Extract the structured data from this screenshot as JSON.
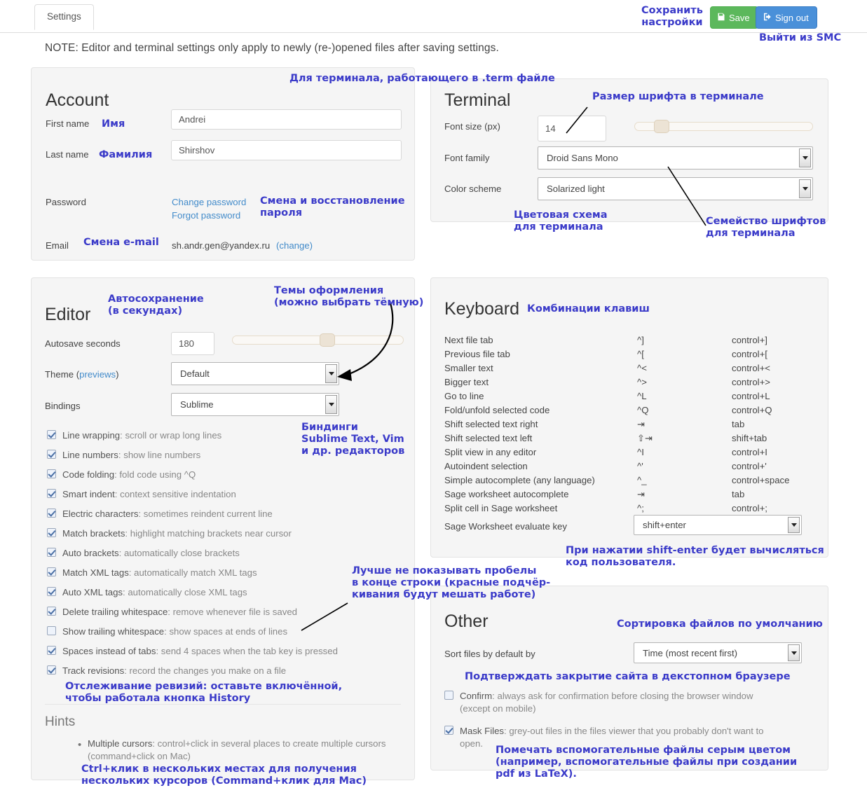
{
  "tab": {
    "label": "Settings"
  },
  "toolbar": {
    "save_label": "Save",
    "save_icon": "floppy-disk-icon",
    "signout_label": "Sign out",
    "signout_icon": "sign-out-icon",
    "save_color": "#5cb85c",
    "signout_color": "#4a90d9"
  },
  "note": "NOTE: Editor and terminal settings only apply to newly (re-)opened files after saving settings.",
  "account": {
    "title": "Account",
    "first_name_label": "First name",
    "first_name_value": "Andrei",
    "last_name_label": "Last name",
    "last_name_value": "Shirshov",
    "password_label": "Password",
    "change_password_link": "Change password",
    "forgot_password_link": "Forgot password",
    "email_label": "Email",
    "email_value": "sh.andr.gen@yandex.ru",
    "email_change_link": "(change)"
  },
  "terminal": {
    "title": "Terminal",
    "font_size_label": "Font size (px)",
    "font_size_value": "14",
    "font_size_slider_pct": 12,
    "font_family_label": "Font family",
    "font_family_value": "Droid Sans Mono",
    "color_scheme_label": "Color scheme",
    "color_scheme_value": "Solarized light"
  },
  "editor": {
    "title": "Editor",
    "autosave_label": "Autosave seconds",
    "autosave_value": "180",
    "autosave_slider_pct": 56,
    "theme_label": "Theme (",
    "theme_previews_link": "previews",
    "theme_label_close": ")",
    "theme_value": "Default",
    "bindings_label": "Bindings",
    "bindings_value": "Sublime",
    "checkboxes": [
      {
        "checked": true,
        "name": "Line wrapping",
        "desc": ": scroll or wrap long lines"
      },
      {
        "checked": true,
        "name": "Line numbers",
        "desc": ": show line numbers"
      },
      {
        "checked": true,
        "name": "Code folding",
        "desc": ": fold code using ^Q"
      },
      {
        "checked": true,
        "name": "Smart indent",
        "desc": ": context sensitive indentation"
      },
      {
        "checked": true,
        "name": "Electric characters",
        "desc": ": sometimes reindent current line"
      },
      {
        "checked": true,
        "name": "Match brackets",
        "desc": ": highlight matching brackets near cursor"
      },
      {
        "checked": true,
        "name": "Auto brackets",
        "desc": ": automatically close brackets"
      },
      {
        "checked": true,
        "name": "Match XML tags",
        "desc": ": automatically match XML tags"
      },
      {
        "checked": true,
        "name": "Auto XML tags",
        "desc": ": automatically close XML tags"
      },
      {
        "checked": true,
        "name": "Delete trailing whitespace",
        "desc": ": remove whenever file is saved"
      },
      {
        "checked": false,
        "name": "Show trailing whitespace",
        "desc": ": show spaces at ends of lines"
      },
      {
        "checked": true,
        "name": "Spaces instead of tabs",
        "desc": ": send 4 spaces when the tab key is pressed"
      },
      {
        "checked": true,
        "name": "Track revisions",
        "desc": ": record the changes you make on a file"
      }
    ],
    "hints_title": "Hints",
    "hint_name": "Multiple cursors",
    "hint_desc": ": control+click in several places to create multiple cursors",
    "hint_desc2": "(command+click on Mac)"
  },
  "keyboard": {
    "title": "Keyboard",
    "rows": [
      {
        "action": "Next file tab",
        "sym": "^]",
        "combo": "control+]"
      },
      {
        "action": "Previous file tab",
        "sym": "^[",
        "combo": "control+["
      },
      {
        "action": "Smaller text",
        "sym": "^<",
        "combo": "control+<"
      },
      {
        "action": "Bigger text",
        "sym": "^>",
        "combo": "control+>"
      },
      {
        "action": "Go to line",
        "sym": "^L",
        "combo": "control+L"
      },
      {
        "action": "Fold/unfold selected code",
        "sym": "^Q",
        "combo": "control+Q"
      },
      {
        "action": "Shift selected text right",
        "sym": "⇥",
        "combo": "tab"
      },
      {
        "action": "Shift selected text left",
        "sym": "⇧⇥",
        "combo": "shift+tab"
      },
      {
        "action": "Split view in any editor",
        "sym": "^I",
        "combo": "control+I"
      },
      {
        "action": "Autoindent selection",
        "sym": "^'",
        "combo": "control+'"
      },
      {
        "action": "Simple autocomplete (any language)",
        "sym": "^_",
        "combo": "control+space"
      },
      {
        "action": "Sage worksheet autocomplete",
        "sym": "⇥",
        "combo": "tab"
      },
      {
        "action": "Split cell in Sage worksheet",
        "sym": "^;",
        "combo": "control+;"
      }
    ],
    "evaluate_key_label": "Sage Worksheet evaluate key",
    "evaluate_key_value": "shift+enter"
  },
  "other": {
    "title": "Other",
    "sort_label": "Sort files by default by",
    "sort_value": "Time (most recent first)",
    "checkboxes": [
      {
        "checked": false,
        "name": "Confirm",
        "desc": ": always ask for confirmation before closing the browser window",
        "desc2": "(except on mobile)"
      },
      {
        "checked": true,
        "name": "Mask Files",
        "desc": ": grey-out files in the files viewer that you probably don't want to",
        "desc2": "open."
      }
    ]
  },
  "annotations": {
    "color": "#3b3bc9",
    "save_settings": "Сохранить\nнастройки",
    "sign_out_smc": "Выйти из SMC",
    "term_file": "Для терминала, работающего в .term файле",
    "first_name": "Имя",
    "last_name": "Фамилия",
    "password_change": "Смена и восстановление\nпароля",
    "email_change": "Смена e-mail",
    "term_font_size": "Размер шрифта в терминале",
    "term_color_scheme": "Цветовая схема\nдля терминала",
    "term_font_family": "Семейство шрифтов\nдля терминала",
    "autosave": "Автосохранение\n(в секундах)",
    "themes": "Темы оформления\n(можно выбрать тёмную)",
    "bindings": "Биндинги\nSublime Text, Vim\nи др. редакторов",
    "trailing_ws": "Лучше не показывать пробелы\nв конце строки (красные подчёр-\nкивания будут мешать работе)",
    "track_revisions": "Отслеживание ревизий: оставьте включённой,\nчтобы работала кнопка History",
    "multiple_cursors": "Ctrl+клик в нескольких местах для получения\nнескольких курсоров (Command+клик для Mac)",
    "keyboard_shortcuts": "Комбинации клавиш",
    "shift_enter": "При нажатии shift-enter будет вычисляться\nкод пользователя.",
    "default_sort": "Сортировка файлов по умолчанию",
    "confirm_close": "Подтверждать закрытие сайта в декстопном браузере",
    "mask_files": "Помечать вспомогательные файлы серым цветом\n(например, вспомогательные файлы при создании\npdf из LaTeX)."
  }
}
